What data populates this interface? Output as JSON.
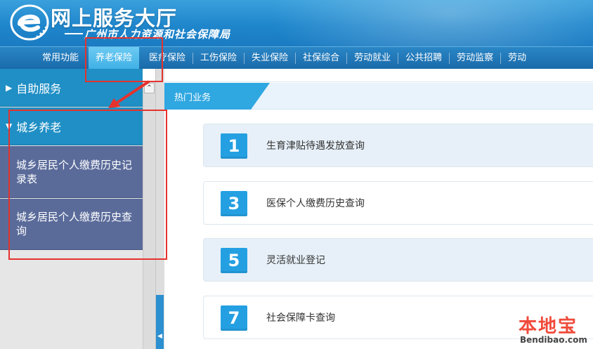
{
  "header": {
    "title": "网上服务大厅",
    "subtitle": "广州市人力资源和社会保障局",
    "logo_icon": "e-logo-icon"
  },
  "nav": {
    "items": [
      {
        "label": "常用功能",
        "active": false
      },
      {
        "label": "养老保险",
        "active": true
      },
      {
        "label": "医疗保险",
        "active": false
      },
      {
        "label": "工伤保险",
        "active": false
      },
      {
        "label": "失业保险",
        "active": false
      },
      {
        "label": "社保综合",
        "active": false
      },
      {
        "label": "劳动就业",
        "active": false
      },
      {
        "label": "公共招聘",
        "active": false
      },
      {
        "label": "劳动监察",
        "active": false
      },
      {
        "label": "劳动",
        "active": false
      }
    ]
  },
  "sidebar": {
    "groups": [
      {
        "label": "自助服务",
        "expanded": false
      },
      {
        "label": "城乡养老",
        "expanded": true
      }
    ],
    "sub_items": [
      {
        "label": "城乡居民个人缴费历史记录表"
      },
      {
        "label": "城乡居民个人缴费历史查询"
      }
    ]
  },
  "content": {
    "section_tab": "热门业务",
    "rows": [
      {
        "num": "1",
        "label": "生育津贴待遇发放查询"
      },
      {
        "num": "3",
        "label": "医保个人缴费历史查询"
      },
      {
        "num": "5",
        "label": "灵活就业登记"
      },
      {
        "num": "7",
        "label": "社会保障卡查询"
      }
    ]
  },
  "watermark": {
    "text": "本地宝",
    "url": "Bendibao.com"
  },
  "colors": {
    "header_blue": "#1f86cc",
    "active_tab": "#3fb0e6",
    "sidebar_group": "#1f8fc5",
    "sidebar_sub": "#5a6b9a",
    "badge_blue": "#24a0e2",
    "annotation_red": "#e5322d"
  }
}
